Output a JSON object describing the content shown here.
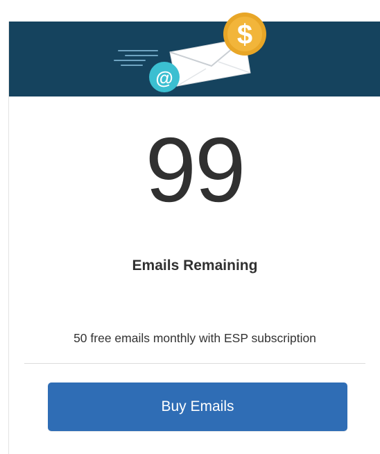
{
  "emails": {
    "remaining_count": "99",
    "remaining_label": "Emails Remaining",
    "note": "50 free emails monthly with ESP subscription"
  },
  "actions": {
    "buy_label": "Buy Emails"
  },
  "colors": {
    "header_bg": "#15435e",
    "button_bg": "#2f6db5",
    "coin": "#e8a627",
    "at_badge": "#3bbfd1"
  },
  "icons": {
    "header": [
      "email-envelope-icon",
      "dollar-coin-icon",
      "at-sign-icon",
      "speed-lines-icon"
    ]
  }
}
